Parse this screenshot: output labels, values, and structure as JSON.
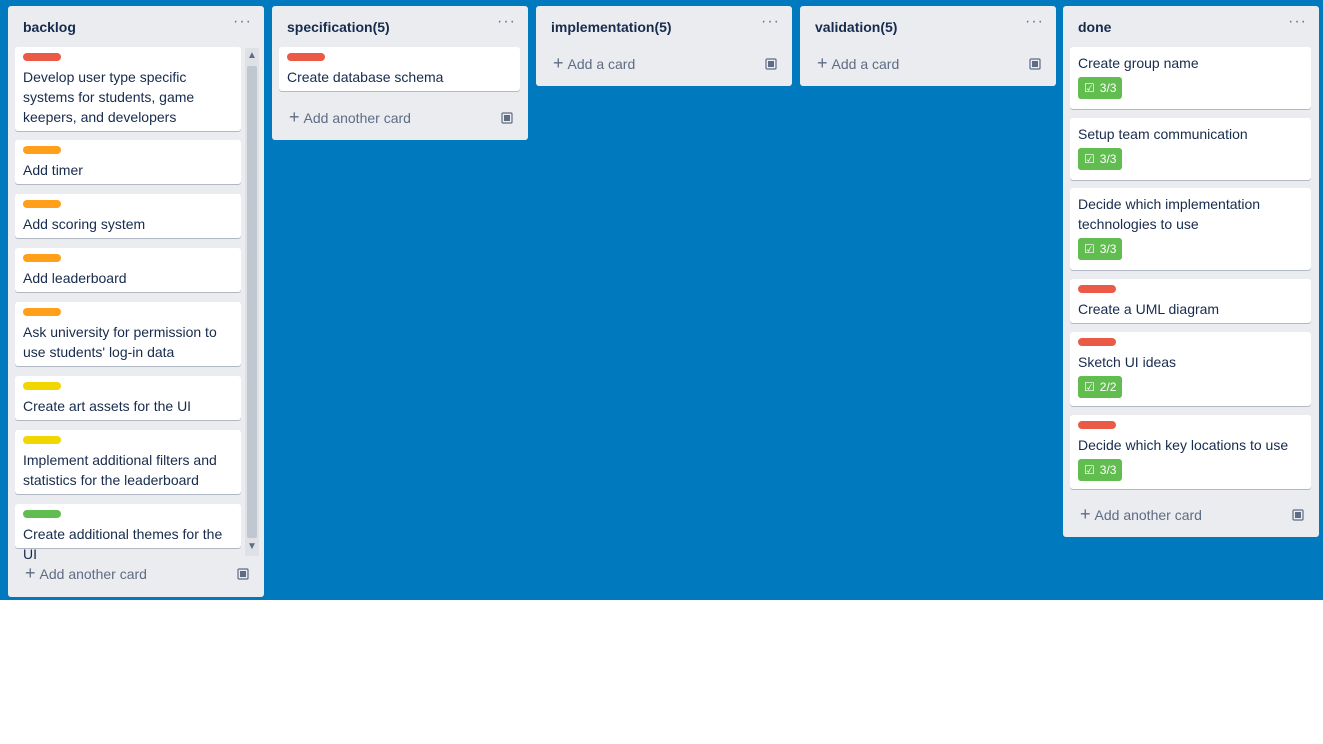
{
  "lists": [
    {
      "title": "backlog",
      "menu": "···",
      "cards": [
        {
          "label_color": "#eb5a46",
          "text": "Develop user type specific systems for students, game keepers, and developers"
        },
        {
          "label_color": "#ff9f1a",
          "text": "Add timer"
        },
        {
          "label_color": "#ff9f1a",
          "text": "Add scoring system"
        },
        {
          "label_color": "#ff9f1a",
          "text": "Add leaderboard"
        },
        {
          "label_color": "#ff9f1a",
          "text": "Ask university for permission to use students' log-in data"
        },
        {
          "label_color": "#f2d600",
          "text": "Create art assets for the UI"
        },
        {
          "label_color": "#f2d600",
          "text": "Implement additional filters and statistics for the leaderboard"
        },
        {
          "label_color": "#61bd4f",
          "text": "Create additional themes for the UI"
        }
      ],
      "add_label": "Add another card"
    },
    {
      "title": "specification(5)",
      "menu": "···",
      "cards": [
        {
          "label_color": "#eb5a46",
          "text": "Create database schema"
        }
      ],
      "add_label": "Add another card"
    },
    {
      "title": "implementation(5)",
      "menu": "···",
      "cards": [],
      "add_label": "Add a card"
    },
    {
      "title": "validation(5)",
      "menu": "···",
      "cards": [],
      "add_label": "Add a card"
    },
    {
      "title": "done",
      "menu": "···",
      "cards": [
        {
          "text": "Create group name",
          "badge": "3/3"
        },
        {
          "text": "Setup team communication",
          "badge": "3/3"
        },
        {
          "text": "Decide which implementation technologies to use",
          "badge": "3/3"
        },
        {
          "label_color": "#eb5a46",
          "text": "Create a UML diagram"
        },
        {
          "label_color": "#eb5a46",
          "text": "Sketch UI ideas",
          "badge": "2/2"
        },
        {
          "label_color": "#eb5a46",
          "text": "Decide which key locations to use",
          "badge": "3/3"
        }
      ],
      "add_label": "Add another card"
    }
  ],
  "icons": {
    "add": "plus-icon",
    "template": "card-template-icon",
    "checklist": "checklist-icon",
    "menu": "more-menu-icon"
  },
  "colors": {
    "board_background": "#0079bf",
    "list_background": "#ebecf0",
    "badge_complete": "#61bd4f"
  }
}
